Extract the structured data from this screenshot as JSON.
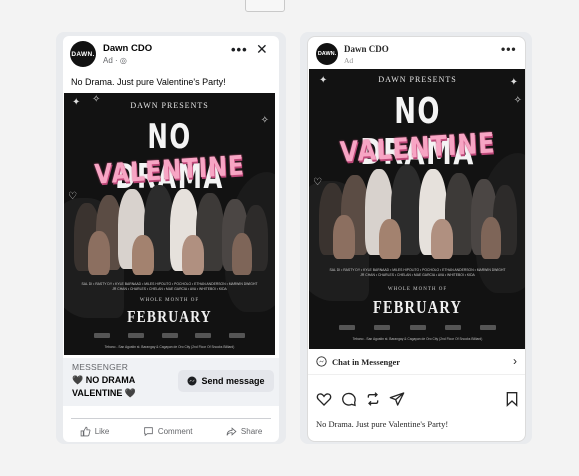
{
  "facebook": {
    "avatar_text": "DAWN.",
    "page_name": "Dawn CDO",
    "sponsored": "Ad · ◎",
    "caption": "No Drama. Just pure Valentine's Party!",
    "cta_label": "MESSENGER",
    "cta_title": "🖤 NO DRAMA VALENTINE 🖤",
    "send_button": "Send message",
    "actions": {
      "like": "Like",
      "comment": "Comment",
      "share": "Share"
    }
  },
  "instagram": {
    "avatar_text": "DAWN.",
    "page_name": "Dawn CDO",
    "sponsored": "Ad",
    "chat_label": "Chat in Messenger",
    "caption": "No Drama. Just pure Valentine's Party!"
  },
  "poster": {
    "presents": "DAWN PRESENTS",
    "title1": "NO DRAMA",
    "title2": "VALENTINE",
    "names_line1": "SAL DI • RASTY DY • KYLE BARNAAD • MILES HIPOLITO • POCHOLO • ETHAN ANDERSON • MARWIN DWIGHT",
    "names_line2": "JR CHAN • CHARLES • CHELAN • MAE GARCIA • AVA • WHITEBOI • KIDA",
    "whole_month": "WHOLE MONTH OF",
    "month": "FEBRUARY",
    "venue": "Tebano - San Agustin st. Barangay & Cagayan de Oro City (2nd Floor Of Snooks Billiard)"
  },
  "colors": {
    "messenger_blue": "#0a7cff",
    "valentine_pink": "#f7a5c4",
    "fb_gray": "#65676b"
  }
}
